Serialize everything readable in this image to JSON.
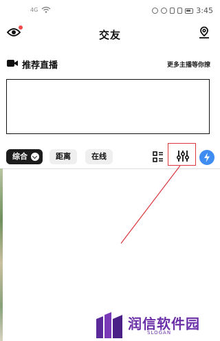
{
  "status_bar": {
    "signal_text": "4G",
    "time": "3:45"
  },
  "header": {
    "title": "交友",
    "has_notification": true
  },
  "live_section": {
    "title": "推荐直播",
    "more_link": "更多主播等你撩"
  },
  "filters": {
    "tabs": [
      {
        "label": "综合",
        "active": true
      },
      {
        "label": "距离",
        "active": false
      },
      {
        "label": "在线",
        "active": false
      }
    ]
  },
  "colors": {
    "annotation_red": "#d9363e",
    "flash_blue": "#3f8cf2",
    "watermark_purple": "#6b2fa8",
    "notification_red": "#f24a4a"
  },
  "icons": {
    "header_left": "eye-icon",
    "header_right": "location-person-icon",
    "live": "camera-icon",
    "view_toggle": "list-grid-icon",
    "filter": "sliders-icon",
    "boost": "lightning-icon"
  },
  "watermark": {
    "title": "润信软件园",
    "subtitle": "SLOGAN"
  }
}
